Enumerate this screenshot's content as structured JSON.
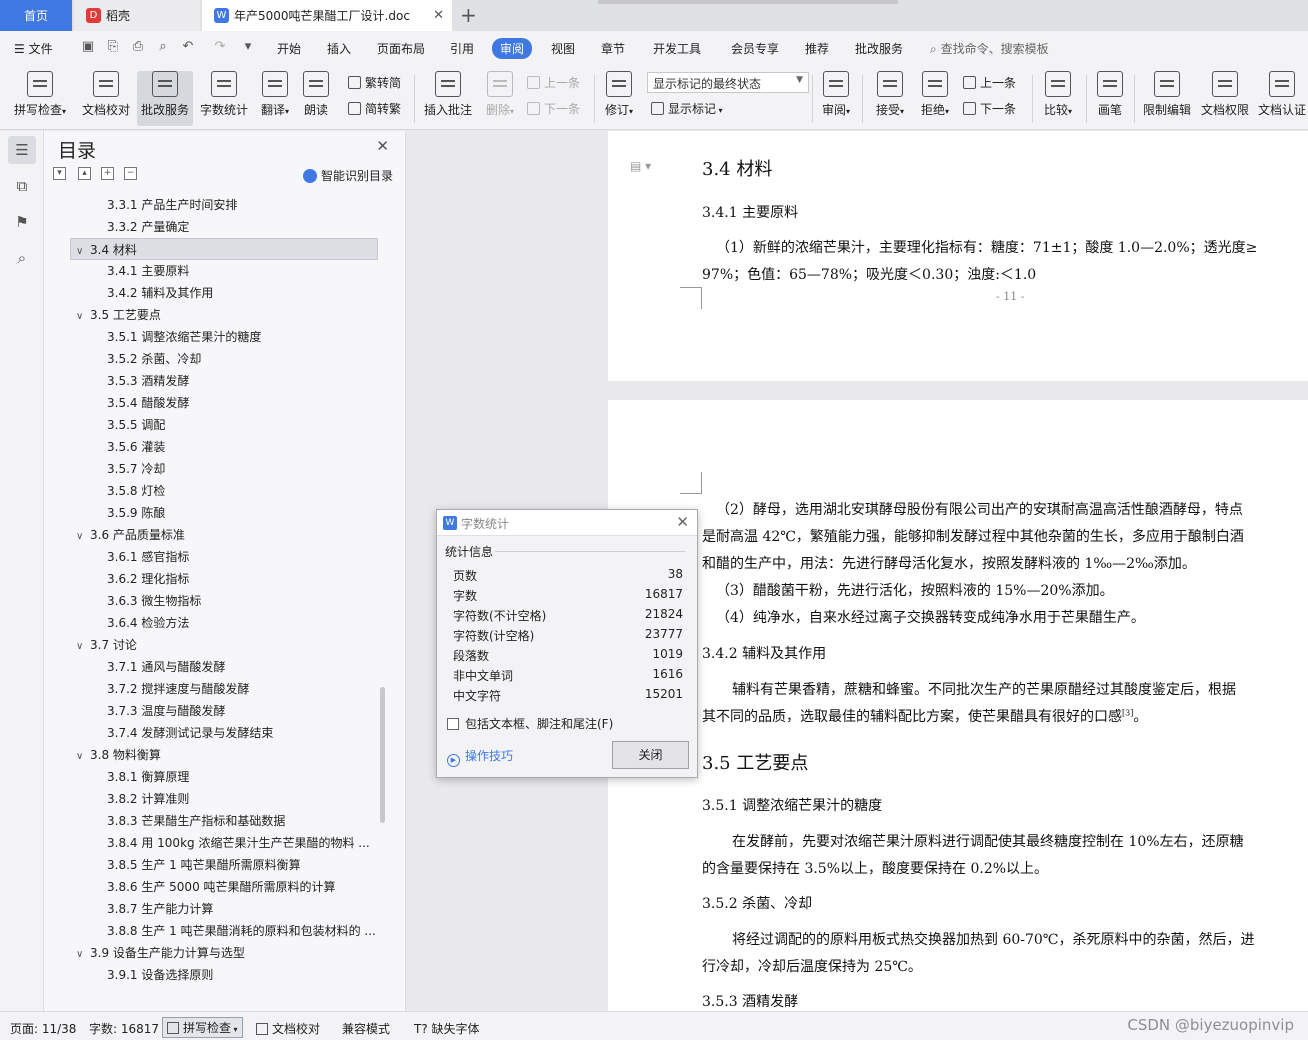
{
  "tabs": {
    "home": "首页",
    "daoke": "稻壳",
    "doc": "年产5000吨芒果醋工厂设计.doc"
  },
  "menu": {
    "file": "文件",
    "items": [
      "开始",
      "插入",
      "页面布局",
      "引用",
      "审阅",
      "视图",
      "章节",
      "开发工具",
      "会员专享",
      "推荐",
      "批改服务"
    ],
    "active": "审阅",
    "search": "查找命令、搜索模板"
  },
  "ribbon": {
    "spell": "拼写检查",
    "proof": "文档校对",
    "review_service": "批改服务",
    "word_count": "字数统计",
    "translate": "翻译",
    "read_aloud": "朗读",
    "trad": "繁转简",
    "simp": "简转繁",
    "insert_comment": "插入批注",
    "delete": "删除",
    "prev": "上一条",
    "next": "下一条",
    "track": "修订",
    "mark_state": "显示标记的最终状态",
    "show_marks": "显示标记",
    "review": "审阅",
    "accept": "接受",
    "reject": "拒绝",
    "prev2": "上一条",
    "next2": "下一条",
    "compare": "比较",
    "pen": "画笔",
    "restrict": "限制编辑",
    "permission": "文档权限",
    "cert": "文档认证"
  },
  "toc": {
    "title": "目录",
    "smart": "智能识别目录",
    "items": [
      {
        "level": 3,
        "text": "3.3.1 产品生产时间安排"
      },
      {
        "level": 3,
        "text": "3.3.2 产量确定"
      },
      {
        "level": 2,
        "text": "3.4 材料",
        "selected": true
      },
      {
        "level": 3,
        "text": "3.4.1 主要原料"
      },
      {
        "level": 3,
        "text": "3.4.2 辅料及其作用"
      },
      {
        "level": 2,
        "text": "3.5 工艺要点"
      },
      {
        "level": 3,
        "text": "3.5.1 调整浓缩芒果汁的糖度"
      },
      {
        "level": 3,
        "text": "3.5.2 杀菌、冷却"
      },
      {
        "level": 3,
        "text": "3.5.3 酒精发酵"
      },
      {
        "level": 3,
        "text": "3.5.4 醋酸发酵"
      },
      {
        "level": 3,
        "text": "3.5.5 调配"
      },
      {
        "level": 3,
        "text": "3.5.6 灌装"
      },
      {
        "level": 3,
        "text": "3.5.7 冷却"
      },
      {
        "level": 3,
        "text": "3.5.8 灯检"
      },
      {
        "level": 3,
        "text": "3.5.9 陈酿"
      },
      {
        "level": 2,
        "text": "3.6 产品质量标准"
      },
      {
        "level": 3,
        "text": "3.6.1 感官指标"
      },
      {
        "level": 3,
        "text": "3.6.2 理化指标"
      },
      {
        "level": 3,
        "text": "3.6.3 微生物指标"
      },
      {
        "level": 3,
        "text": "3.6.4 检验方法"
      },
      {
        "level": 2,
        "text": "3.7 讨论"
      },
      {
        "level": 3,
        "text": "3.7.1 通风与醋酸发酵"
      },
      {
        "level": 3,
        "text": "3.7.2 搅拌速度与醋酸发酵"
      },
      {
        "level": 3,
        "text": "3.7.3 温度与醋酸发酵"
      },
      {
        "level": 3,
        "text": "3.7.4 发酵测试记录与发酵结束"
      },
      {
        "level": 2,
        "text": "3.8 物料衡算"
      },
      {
        "level": 3,
        "text": "3.8.1 衡算原理"
      },
      {
        "level": 3,
        "text": "3.8.2 计算准则"
      },
      {
        "level": 3,
        "text": "3.8.3 芒果醋生产指标和基础数据"
      },
      {
        "level": 3,
        "text": "3.8.4 用 100kg 浓缩芒果汁生产芒果醋的物料 ..."
      },
      {
        "level": 3,
        "text": "3.8.5 生产 1 吨芒果醋所需原料衡算"
      },
      {
        "level": 3,
        "text": "3.8.6 生产 5000 吨芒果醋所需原料的计算"
      },
      {
        "level": 3,
        "text": "3.8.7 生产能力计算"
      },
      {
        "level": 3,
        "text": "3.8.8 生产 1 吨芒果醋消耗的原料和包装材料的 ..."
      },
      {
        "level": 2,
        "text": "3.9 设备生产能力计算与选型"
      },
      {
        "level": 3,
        "text": "3.9.1 设备选择原则"
      }
    ]
  },
  "doc": {
    "page1": {
      "h2": "3.4  材料",
      "h3": "3.4.1  主要原料",
      "p1": "（1）新鲜的浓缩芒果汁，主要理化指标有：糖度：71±1；酸度 1.0—2.0%；透光度≥",
      "p2": "97%；色值：65—78%；吸光度＜0.30；浊度:＜1.0",
      "page_num": "- 11 -"
    },
    "page2": {
      "lines": [
        "（2）酵母，选用湖北安琪酵母股份有限公司出产的安琪耐高温高活性酿酒酵母，特点",
        "是耐高温 42℃，繁殖能力强，能够抑制发酵过程中其他杂菌的生长，多应用于酿制白酒",
        "和醋的生产中，用法：先进行酵母活化复水，按照发酵料液的 1‰—2‰添加。",
        "（3）醋酸菌干粉，先进行活化，按照料液的 15%—20%添加。",
        "（4）纯净水，自来水经过离子交换器转变成纯净水用于芒果醋生产。"
      ],
      "h3_342": "3.4.2  辅料及其作用",
      "p342a": "辅料有芒果香精，蔗糖和蜂蜜。不同批次生产的芒果原醋经过其酸度鉴定后，根据",
      "p342b": "其不同的品质，选取最佳的辅料配比方案，使芒果醋具有很好的口感",
      "ref": "[3]",
      "p342b_end": "。",
      "h2_35": "3.5  工艺要点",
      "h3_351": "3.5.1  调整浓缩芒果汁的糖度",
      "p351a": "在发酵前，先要对浓缩芒果汁原料进行调配使其最终糖度控制在 10%左右，还原糖",
      "p351b": "的含量要保持在 3.5%以上，酸度要保持在 0.2%以上。",
      "h3_352": "3.5.2  杀菌、冷却",
      "p352a": "将经过调配的的原料用板式热交换器加热到 60-70℃，杀死原料中的杂菌，然后，进",
      "p352b": "行冷却，冷却后温度保持为 25℃。",
      "h3_353": "3.5.3  酒精发酵"
    }
  },
  "dialog": {
    "title": "字数统计",
    "section": "统计信息",
    "rows": [
      {
        "k": "页数",
        "v": "38"
      },
      {
        "k": "字数",
        "v": "16817"
      },
      {
        "k": "字符数(不计空格)",
        "v": "21824"
      },
      {
        "k": "字符数(计空格)",
        "v": "23777"
      },
      {
        "k": "段落数",
        "v": "1019"
      },
      {
        "k": "非中文单词",
        "v": "1616"
      },
      {
        "k": "中文字符",
        "v": "15201"
      }
    ],
    "checkbox": "包括文本框、脚注和尾注(F)",
    "tips": "操作技巧",
    "close": "关闭"
  },
  "status": {
    "page": "页面: 11/38",
    "words": "字数: 16817",
    "spell": "拼写检查",
    "proof": "文档校对",
    "compat": "兼容模式",
    "font": "缺失字体"
  },
  "watermark": "CSDN @biyezuopinvip"
}
